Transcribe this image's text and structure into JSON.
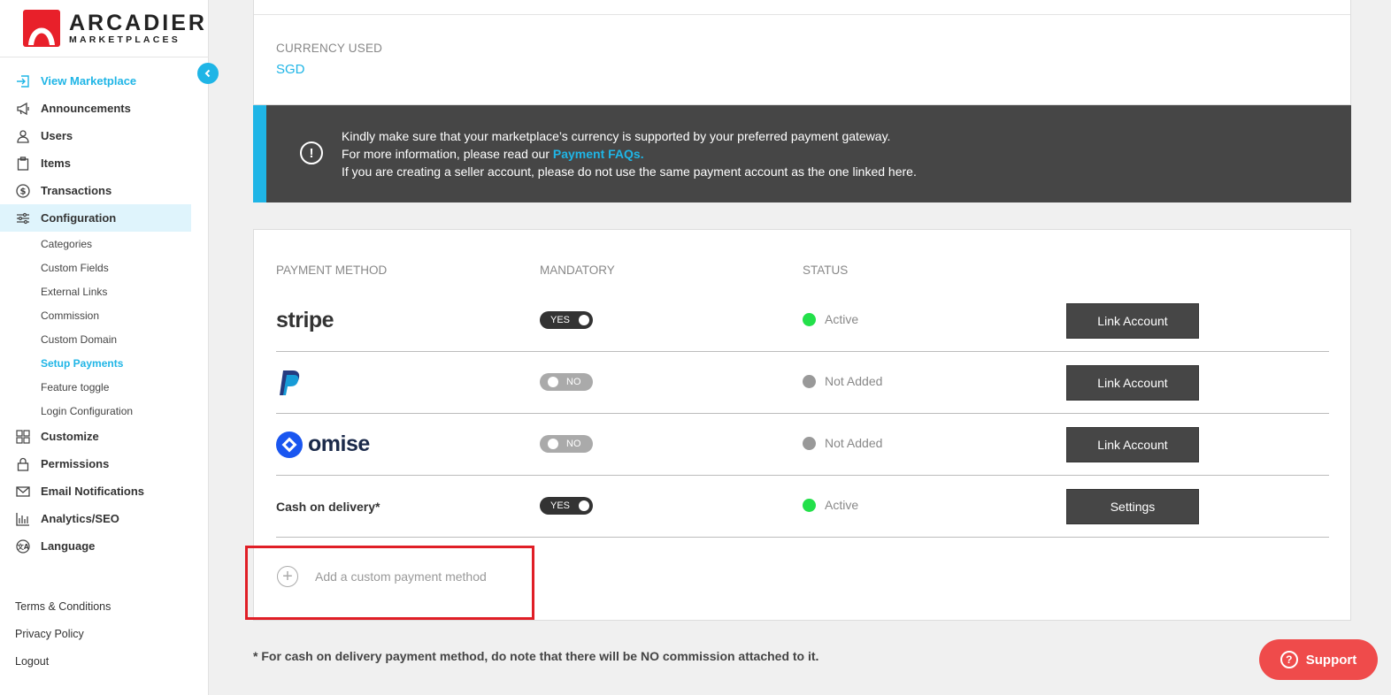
{
  "brand": {
    "name": "ARCADIER",
    "tagline": "MARKETPLACES"
  },
  "sidebar": {
    "items": [
      {
        "label": "View Marketplace",
        "icon": "enter-icon"
      },
      {
        "label": "Announcements",
        "icon": "megaphone-icon"
      },
      {
        "label": "Users",
        "icon": "user-icon"
      },
      {
        "label": "Items",
        "icon": "clipboard-icon"
      },
      {
        "label": "Transactions",
        "icon": "dollar-icon"
      },
      {
        "label": "Configuration",
        "icon": "sliders-icon"
      }
    ],
    "config_sub": [
      "Categories",
      "Custom Fields",
      "External Links",
      "Commission",
      "Custom Domain",
      "Setup Payments",
      "Feature toggle",
      "Login Configuration"
    ],
    "items_after": [
      {
        "label": "Customize",
        "icon": "grid-icon"
      },
      {
        "label": "Permissions",
        "icon": "lock-icon"
      },
      {
        "label": "Email Notifications",
        "icon": "mail-icon"
      },
      {
        "label": "Analytics/SEO",
        "icon": "bar-chart-icon"
      },
      {
        "label": "Language",
        "icon": "language-icon"
      }
    ],
    "footer": [
      "Terms & Conditions",
      "Privacy Policy",
      "Logout"
    ]
  },
  "currency": {
    "label": "CURRENCY USED",
    "value": "SGD"
  },
  "notice": {
    "line1": "Kindly make sure that your marketplace’s currency is supported by your preferred payment gateway.",
    "line2_prefix": "For more information, please read our ",
    "line2_link": "Payment FAQs.",
    "line3": "If you are creating a seller account, please do not use the same payment account as the one linked here."
  },
  "table": {
    "headers": {
      "method": "PAYMENT METHOD",
      "mandatory": "MANDATORY",
      "status": "STATUS"
    },
    "rows": [
      {
        "method": "stripe",
        "mandatory": "YES",
        "status": "Active",
        "button": "Link Account"
      },
      {
        "method": "PayPal",
        "mandatory": "NO",
        "status": "Not Added",
        "button": "Link Account"
      },
      {
        "method": "omise",
        "mandatory": "NO",
        "status": "Not Added",
        "button": "Link Account"
      },
      {
        "method": "Cash on delivery*",
        "mandatory": "YES",
        "status": "Active",
        "button": "Settings"
      }
    ]
  },
  "add_custom": {
    "label": "Add a custom payment method"
  },
  "footnote": "* For cash on delivery payment method, do note that there will be NO commission attached to it.",
  "support": {
    "label": "Support"
  },
  "colors": {
    "accent": "#1fb5e6",
    "brand_red": "#e8202a",
    "active": "#23e04a",
    "support": "#ef4b4b"
  }
}
